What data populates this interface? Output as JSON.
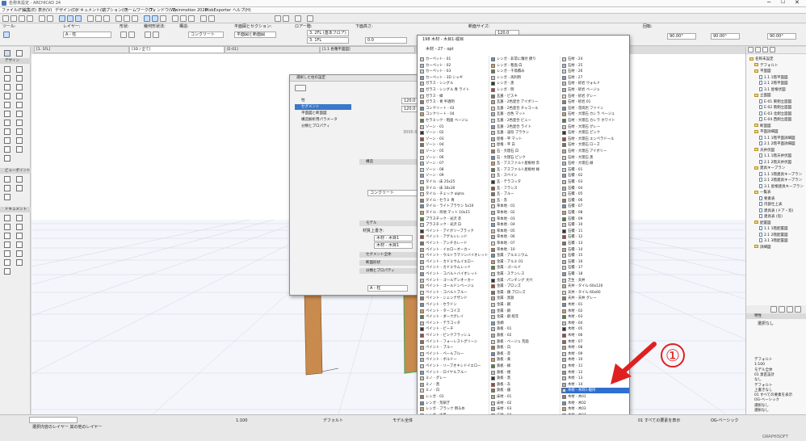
{
  "window_title": "名称未設定 - ARCHICAD 24",
  "menu": [
    "ファイル(F)",
    "編集(E)",
    "表示(V)",
    "デザイン(D)",
    "ドキュメント(U)",
    "オプション(O)",
    "チームワーク(T)",
    "ウィンドウ(W)",
    "Twinmotion 2020",
    "MobExporter",
    "ヘルプ(H)"
  ],
  "info_box": {
    "labels": [
      "ツール:",
      "レイヤー:",
      "形状:",
      "幾何形状法:",
      "構造:",
      "平面図とセクション:",
      "ロアー階:",
      "アッパー階:",
      "下面高さ:",
      "上面高さ:",
      "断面形状:",
      "高さ:",
      "幅:",
      "長さ:",
      "断面サイズ:",
      "回転:"
    ],
    "layer_value": "A - 柱",
    "structure_value": "コンクリート",
    "section_value": "平面図と断面図",
    "story_top": "3. 2FL (基本フロア)",
    "story_bottom": "3. 1FL",
    "offset_value": "0.0",
    "height_value": "3000.0",
    "size_value": "120.0",
    "rotation_value": "0.00°",
    "angle_value": "90.00°"
  },
  "tabs": [
    "[1. 1FL]",
    "[3D / 全て]",
    "[E-01]",
    "[1.1 各種平面図]"
  ],
  "toolbox": {
    "sections": [
      "デザイン",
      "ビューポイント",
      "ドキュメント"
    ],
    "design_tools": [
      "壁",
      "柱",
      "梁",
      "スラブ",
      "屋根",
      "シェル",
      "モルフ",
      "階段",
      "手摺",
      "カーテンウォール",
      "ドア",
      "窓",
      "オブジェクト",
      "ゾーン",
      "メッシュ"
    ]
  },
  "dialog": {
    "title": "選択した柱の設定",
    "tree": [
      "柱",
      "セグメント",
      "平面図と断面図",
      "構造解析用パラメータ",
      "分類とプロパティ"
    ],
    "sizes": [
      "120.0",
      "120.0",
      "3000.0"
    ],
    "panel_headers": [
      "構造",
      "モデル"
    ],
    "structure_label": "コンクリート",
    "overrides_label": "材質上書き:",
    "surface_top": "木材 - 木目1",
    "surface_side": "木材 - 木目1",
    "sections": [
      "セグメント全体",
      "断面形状",
      "分類とプロパティ"
    ],
    "layer_value": "A - 柱",
    "seg_label": "セグメント表面",
    "ok_label": "OK",
    "cancel_label": "キャンセル"
  },
  "popup": {
    "count_label": "198 木材 - 木目1-縦目",
    "header_item": "木材 - 27 - opt",
    "col1": [
      "カーペット - 01",
      "カーペット - 02",
      "カーペット - 03",
      "カーペット - 3D シャギ",
      "ガラス - シングル",
      "ガラス - シングル 青 ライト",
      "ガラス - 緑",
      "ガラス - 青 半透明",
      "コンクリート - 03",
      "コンクリート - 04",
      "セラミック - 粗面 ベージュ",
      "ゾーン - 01",
      "ゾーン - 02",
      "ゾーン - 03",
      "ゾーン - 04",
      "ゾーン - 05",
      "ゾーン - 06",
      "ゾーン - 07",
      "ゾーン - 08",
      "ゾーン - 09",
      "タイル - 床 25x25",
      "タイル - 床 30x30",
      "タイル - チェック alpha",
      "タイル - セラミ 青",
      "タイル - ライトブラウン 5x10",
      "タイル - 目地 マット 10x15",
      "プラスチック - 光沢 赤",
      "プラスチック - 光沢 白",
      "ペイント - アイボリーブラック",
      "ペイント - アゲルシレッド",
      "ペイント - アンチカレード",
      "ペイント - イエローオーカー",
      "ペイント - ウルトラマリンバイオレット",
      "ペイント - カドミウムイエロー",
      "ペイント - カドミウムレッド",
      "ペイント - コバルトバイオレット",
      "ペイント - ゴールデンオーカー",
      "ペイント - ゴールドンベージュ",
      "ペイント - コバルトブルー",
      "ペイント - シェンナザンド",
      "ペイント - セラドン",
      "ペイント - ターコイズ",
      "ペイント - ダークグレイ",
      "ペイント - テラコッタ",
      "ペイント - ピーチ",
      "ペイント - ピンクフラッシュ",
      "ペイント - フォーレストグリーン",
      "ペイント - ブルー",
      "ペイント - ペールブルー",
      "ペイント - ボルドー",
      "ペイント - リーブオキシドイエロー",
      "ペイント - ロイヤルブルー",
      "ミノ - グレー",
      "ミノ - 黒",
      "ミノ - 白",
      "レンガ - 01",
      "レンガ - 荒研ぎ",
      "レンガ - ブラック 明るめ",
      "レンガ - 古風",
      "レンガ - 上塗り",
      "レンガ - 赤"
    ],
    "col2": [
      "レンガ - 非常に傷付 擦り",
      "レンガ - 粗面 白",
      "レンガ - 千鳥積み",
      "レンガ - 再利用",
      "レンガ - 黒",
      "レンガ - 明",
      "瓦葺 - ピスキ",
      "瓦葺 - 2色混合 アイボリー",
      "瓦葺 - 2色混合 チャコール",
      "瓦葺 - 古色 マット",
      "瓦葺 - 2色混合 ビュー",
      "瓦葺 - 2色混合 ライト",
      "瓦葺 - 波形 ブラウン",
      "屋根 - 平 マット",
      "屋根 - 平 白",
      "石 - 大理石 白",
      "石 - 大理石 ピンク",
      "瓦 - アスファルト屋根材 赤",
      "瓦 - アスファルト屋根材 緑",
      "瓦 - スペイン",
      "瓦 - テラコッタ",
      "瓦 - フランス",
      "瓦 - ブルー",
      "瓦 - 赤",
      "草本地 - 01",
      "草本地 - 02",
      "草本地 - 03",
      "草本地 - 04",
      "草本地 - 05",
      "草本地 - 06",
      "草本地 - 07",
      "草本地 - 10",
      "金属 - アルミニウム",
      "金属 - アルミ 01",
      "金属 - ゴールド",
      "金属 - ステンレス",
      "金属 - パンチング 大穴",
      "金属 - ブロンズ",
      "金属 - 錆 ブロンズ",
      "金属 - 黒鉄",
      "金属 - 鋼",
      "金属 - 銅",
      "金属 - 銅 経年",
      "金網",
      "鉄板 - 01",
      "鉄板 - 02",
      "鉄板 - ベージュ 荒面",
      "鉄板 - 白",
      "鉄板 - 赤",
      "鉄板 - 黄",
      "鉄板 - 緑",
      "鉄板 - 紺",
      "鉄板 - 黒",
      "鉄板 - 灰",
      "鉄板 - 銀",
      "床材 - 01",
      "床材 - 02",
      "床材 - 03",
      "床材 - 04",
      "床材 - 05",
      "床材 - 06"
    ],
    "col3": [
      "石材 - 24",
      "石材 - 25",
      "石材 - 26",
      "石材 - 27",
      "石材 - 砂岩 ウォルド",
      "石材 - 砂岩 ベージュ",
      "石材 - 砂岩 グレー",
      "石材 - 砂岩 01",
      "石材 - 花崗岩 ファイン",
      "石材 - 大理石 カレラ ベージュ",
      "石材 - 大理石 カレラ ホワイト",
      "石材 - 大理石 グレー",
      "石材 - 大理石 ピンク",
      "石材 - 大理石 エンペラドール",
      "石材 - 大理石 ローズ",
      "石材 - 大理石 アイボリー",
      "石材 - 大理石 黒",
      "石材 - 大理石 緑",
      "石積 - 01",
      "石積 - 02",
      "石積 - 03",
      "石積 - 04",
      "石積 - 05",
      "石積 - 06",
      "石積 - 07",
      "石積 - 08",
      "石積 - 09",
      "石積 - 10",
      "石積 - 11",
      "石積 - 12",
      "石積 - 13",
      "石積 - 14",
      "石積 - 15",
      "石積 - 16",
      "石積 - 17",
      "石積 - 18",
      "芝生 - 天井",
      "天井 - タイル 60x120",
      "天井 - タイル 60x60",
      "天井 - 天井 グレー",
      "木材 - 01",
      "木材 - 02",
      "木材 - 03",
      "木材 - 04",
      "木材 - 05",
      "木材 - 06",
      "木材 - 07",
      "木材 - 08",
      "木材 - 09",
      "木材 - 10",
      "木材 - 11",
      "木材 - 12",
      "木材 - 13",
      "木材 - 14",
      "木材 - 木目1-縦目",
      "木材 - 木01",
      "木材 - 木02",
      "木材 - 木03",
      "木材 - 木04",
      "木材 - 木05",
      "木材 - 木06"
    ],
    "selected_item": "木材 - 木目1-縦目"
  },
  "navigator": {
    "header": "プロジェクト一覧",
    "items": [
      "名称未設定",
      "デフォルト",
      "平面図",
      "1.1 1階平面図",
      "2.1 2階平面図",
      "3.1 屋根伏図",
      "立面図",
      "E-01 東側立面図",
      "E-02 南側立面図",
      "E-03 北側立面図",
      "E-04 西側立面図",
      "断面図",
      "平面詳細図",
      "1.1 1階平面詳細図",
      "2.1 2階平面詳細図",
      "天井伏図",
      "1.1 1階天井伏図",
      "2.1 2階天井伏図",
      "建具キープラン",
      "1.1 1階建具キープラン",
      "2.1 2階建具キープラン",
      "3.1 屋根建具キープラン",
      "一覧表",
      "要素表",
      "内部仕上表",
      "建具表 (ドア・窓)",
      "建具表 (窓)",
      "配置図",
      "1.1 1階配置図",
      "2.1 2階配置図",
      "3.1 3階配置図",
      "詳細図"
    ],
    "props_header": "特性",
    "props_value": "選択なし",
    "lower_items": [
      "デフォルト",
      "1:100",
      "モデル全体",
      "01 意匠設計",
      "なし",
      "デフォルト",
      "上書きなし",
      "01 すべての要素を表示",
      "OG-ベーシック",
      "選択なし",
      "選択なし"
    ]
  },
  "statusbar": {
    "layer_text": "選択内容のレイヤー 其の他のレイヤー",
    "scale": "1:100",
    "override": "デフォルト",
    "model": "モデル全体",
    "view": "01 すべての要素を表示",
    "renovation": "OG-ベーシック",
    "brand": "GRAPHISOFT"
  },
  "annotation": {
    "marker": "①",
    "arrow_color": "#e02020"
  }
}
